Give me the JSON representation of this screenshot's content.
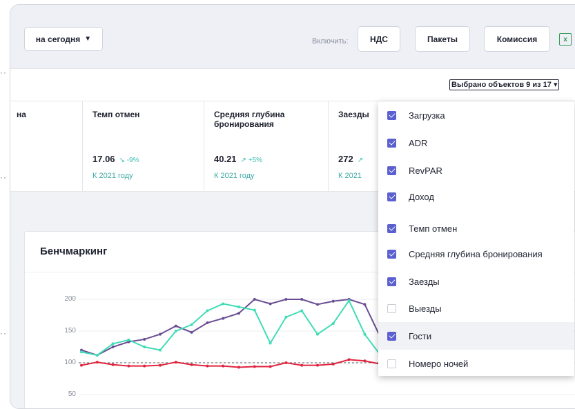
{
  "toolbar": {
    "period_label": "на сегодня",
    "include_label": "Включить:",
    "nds_label": "НДС",
    "packages_label": "Пакеты",
    "commission_label": "Комиссия"
  },
  "selection": {
    "summary": "Выбрано объектов 9 из 17"
  },
  "metrics": [
    {
      "title": "на"
    },
    {
      "title": "Темп отмен",
      "value": "17.06",
      "delta": "↘ -9%",
      "link": "К 2021 году"
    },
    {
      "title_line1": "Средняя глубина",
      "title_line2": "бронирования",
      "value": "40.21",
      "delta": "↗ +5%",
      "link": "К 2021 году"
    },
    {
      "title": "Заезды",
      "value": "272",
      "delta": "↗",
      "link": "К 2021"
    }
  ],
  "dropdown": {
    "items": [
      {
        "label": "Загрузка",
        "checked": true
      },
      {
        "label": "ADR",
        "checked": true
      },
      {
        "label": "RevPAR",
        "checked": true
      },
      {
        "label": "Доход",
        "checked": true
      },
      {
        "label": "Темп отмен",
        "checked": true
      },
      {
        "label": "Средняя глубина бронирования",
        "checked": true
      },
      {
        "label": "Заезды",
        "checked": true
      },
      {
        "label": "Выезды",
        "checked": false
      },
      {
        "label": "Гости",
        "checked": true
      },
      {
        "label": "Номеро ночей",
        "checked": false
      }
    ]
  },
  "chart": {
    "title": "Бенчмаркинг"
  },
  "colors": {
    "accent_purple": "#5b5fcf",
    "teal": "#3dbcae",
    "series_purple": "#6a4c93",
    "series_teal": "#3fdcb5",
    "series_red": "#e0233f"
  },
  "chart_data": {
    "type": "line",
    "ylim": [
      50,
      210
    ],
    "yticks": [
      50,
      100,
      150,
      200
    ],
    "x": [
      1,
      2,
      3,
      4,
      5,
      6,
      7,
      8,
      9,
      10,
      11,
      12,
      13,
      14,
      15,
      16,
      17,
      18,
      19,
      20,
      21,
      22,
      23
    ],
    "reference_line": 100,
    "series": [
      {
        "color": "#6a4c93",
        "values": [
          120,
          112,
          125,
          133,
          137,
          145,
          158,
          148,
          163,
          170,
          178,
          200,
          193,
          200,
          200,
          192,
          197,
          200,
          192,
          140
        ]
      },
      {
        "color": "#3fdcb5",
        "values": [
          117,
          112,
          130,
          136,
          125,
          120,
          150,
          160,
          182,
          193,
          188,
          183,
          131,
          172,
          182,
          145,
          162,
          198,
          145,
          112
        ]
      },
      {
        "color": "#e0233f",
        "values": [
          96,
          101,
          97,
          95,
          95,
          96,
          101,
          97,
          95,
          95,
          93,
          94,
          94,
          100,
          96,
          96,
          98,
          105,
          103,
          98
        ]
      }
    ]
  }
}
